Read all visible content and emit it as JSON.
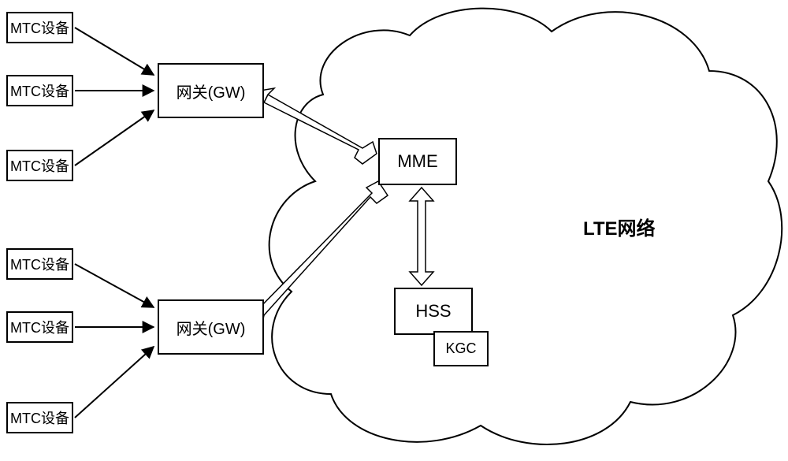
{
  "diagram": {
    "mtcGroup1": {
      "item1": "MTC设备",
      "item2": "MTC设备",
      "item3": "MTC设备"
    },
    "mtcGroup2": {
      "item1": "MTC设备",
      "item2": "MTC设备",
      "item3": "MTC设备"
    },
    "gateway1": "网关(GW)",
    "gateway2": "网关(GW)",
    "mme": "MME",
    "hss": "HSS",
    "kgc": "KGC",
    "network_label": "LTE网络"
  }
}
